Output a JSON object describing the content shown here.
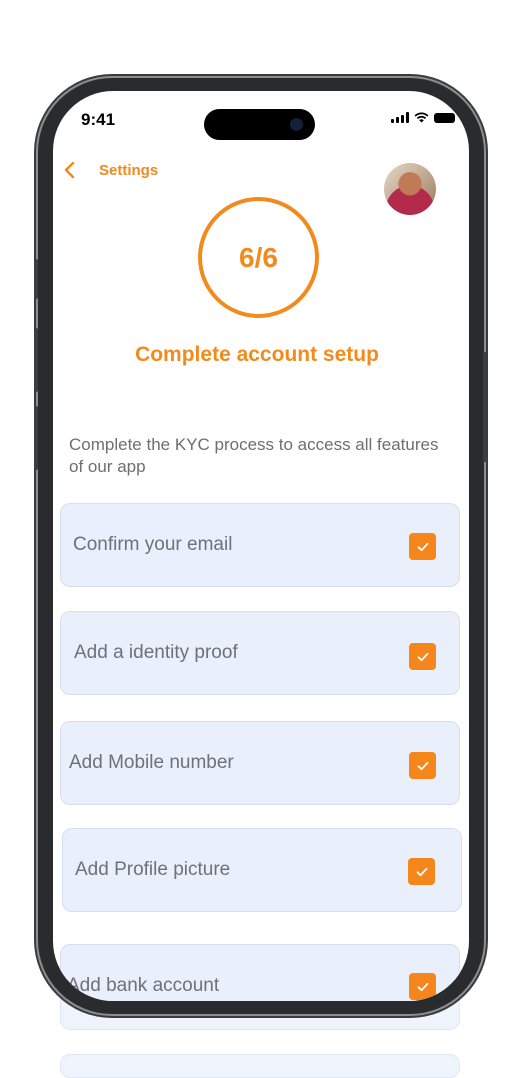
{
  "status_bar": {
    "time": "9:41"
  },
  "nav": {
    "back_label": "Settings"
  },
  "progress": {
    "text": "6/6",
    "completed": 6,
    "total": 6
  },
  "setup_title": "Complete account setup",
  "intro_text": "Complete the KYC process to access all features of our app",
  "checklist": [
    {
      "label": "Confirm your email",
      "checked": true
    },
    {
      "label": "Add a identity proof",
      "checked": true
    },
    {
      "label": "Add Mobile number",
      "checked": true
    },
    {
      "label": "Add Profile picture",
      "checked": true
    },
    {
      "label": "Add bank account",
      "checked": true
    }
  ],
  "colors": {
    "accent": "#f28a1c",
    "card_bg": "#e9effb",
    "text_muted": "#6e6e73"
  },
  "icons": {
    "back": "chevron-left-icon",
    "check": "checkmark-icon",
    "avatar": "profile-photo"
  }
}
